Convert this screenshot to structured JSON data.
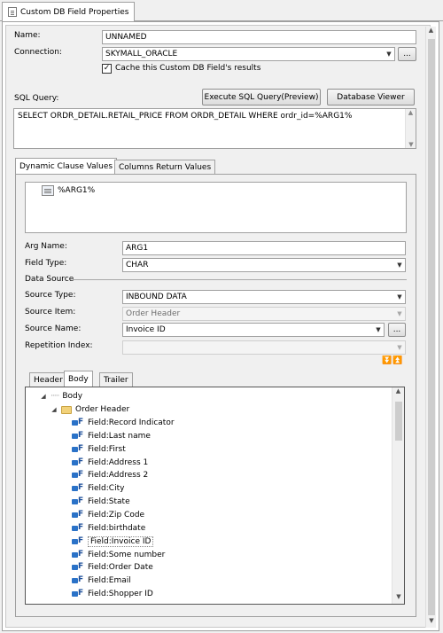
{
  "document_tab": {
    "title": "Custom DB Field Properties",
    "icon": "document-icon"
  },
  "form": {
    "name_label": "Name:",
    "name_value": "UNNAMED",
    "connection_label": "Connection:",
    "connection_value": "SKYMALL_ORACLE",
    "connection_browse": "...",
    "cache_checked": true,
    "cache_label": "Cache this Custom DB Field's results",
    "sql_label": "SQL Query:",
    "execute_button": "Execute SQL Query(Preview)",
    "db_viewer_button": "Database Viewer",
    "sql_value": "SELECT ORDR_DETAIL.RETAIL_PRICE FROM ORDR_DETAIL  WHERE ordr_id=%ARG1%"
  },
  "tabs": {
    "dynamic_clause": "Dynamic Clause Values",
    "columns_return": "Columns Return Values"
  },
  "args_list": {
    "items": [
      "%ARG1%"
    ]
  },
  "arg": {
    "arg_name_label": "Arg Name:",
    "arg_name_value": "ARG1",
    "field_type_label": "Field Type:",
    "field_type_value": "CHAR",
    "data_source_label": "Data Source",
    "source_type_label": "Source Type:",
    "source_type_value": "INBOUND DATA",
    "source_item_label": "Source Item:",
    "source_item_value": "Order Header",
    "source_name_label": "Source Name:",
    "source_name_value": "Invoice ID",
    "source_name_browse": "...",
    "repetition_label": "Repetition Index:",
    "repetition_value": ""
  },
  "tree_tabs": {
    "header": "Header",
    "body": "Body",
    "trailer": "Trailer"
  },
  "tree": {
    "root": "Body",
    "folder": "Order Header",
    "fields": [
      "Field:Record Indicator",
      "Field:Last name",
      "Field:First",
      "Field:Address 1",
      "Field:Address 2",
      "Field:City",
      "Field:State",
      "Field:Zip Code",
      "Field:birthdate",
      "Field:Invoice ID",
      "Field:Some number",
      "Field:Order Date",
      "Field:Email",
      "Field:Shopper ID"
    ],
    "selected_field": "Field:Invoice ID"
  },
  "colors": {
    "accent": "#2a72c8",
    "folder": "#f2d27a",
    "panel_bg": "#f0f0f0"
  }
}
